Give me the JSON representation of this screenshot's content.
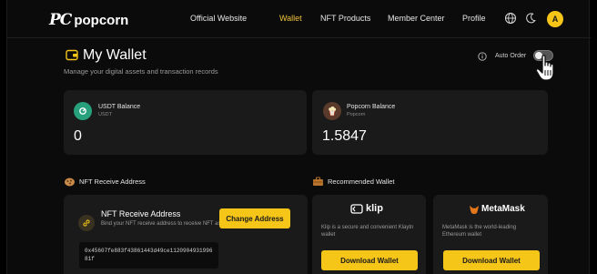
{
  "brand": {
    "mark": "PC",
    "name": "popcorn"
  },
  "nav": {
    "items": [
      {
        "label": "Official Website"
      },
      {
        "label": "Wallet"
      },
      {
        "label": "NFT Products"
      },
      {
        "label": "Member Center"
      },
      {
        "label": "Profile"
      }
    ],
    "avatar_initial": "A"
  },
  "page": {
    "title": "My Wallet",
    "subtitle": "Manage your digital assets and transaction records",
    "auto_order_label": "Auto Order",
    "auto_order_on": false
  },
  "balances": [
    {
      "label": "USDT Balance",
      "sub": "USDT",
      "value": "0",
      "icon": "usdt-coin-icon",
      "color": "#26a17b"
    },
    {
      "label": "Popcorn Balance",
      "sub": "Popcorn",
      "value": "1.5847",
      "icon": "popcorn-coin-icon",
      "color": "#5a3a2a"
    }
  ],
  "nft_section": {
    "title": "NFT Receive Address",
    "card_title": "NFT Receive Address",
    "card_desc": "Bind your NFT receive address to receive NFT assets",
    "button": "Change Address",
    "address": "0x45607fe883f43861443d49ce112090493199681f"
  },
  "wallet_section": {
    "title": "Recommended Wallet",
    "wallets": [
      {
        "name": "klip",
        "desc": "Klip is a secure and convenient Klaytn wallet",
        "button": "Download Wallet"
      },
      {
        "name": "MetaMask",
        "desc": "MetaMask is the world-leading Ethereum wallet",
        "button": "Download Wallet"
      }
    ]
  },
  "colors": {
    "accent": "#f5c518",
    "active_nav": "#f0c33c",
    "card": "#1a1a1a"
  }
}
